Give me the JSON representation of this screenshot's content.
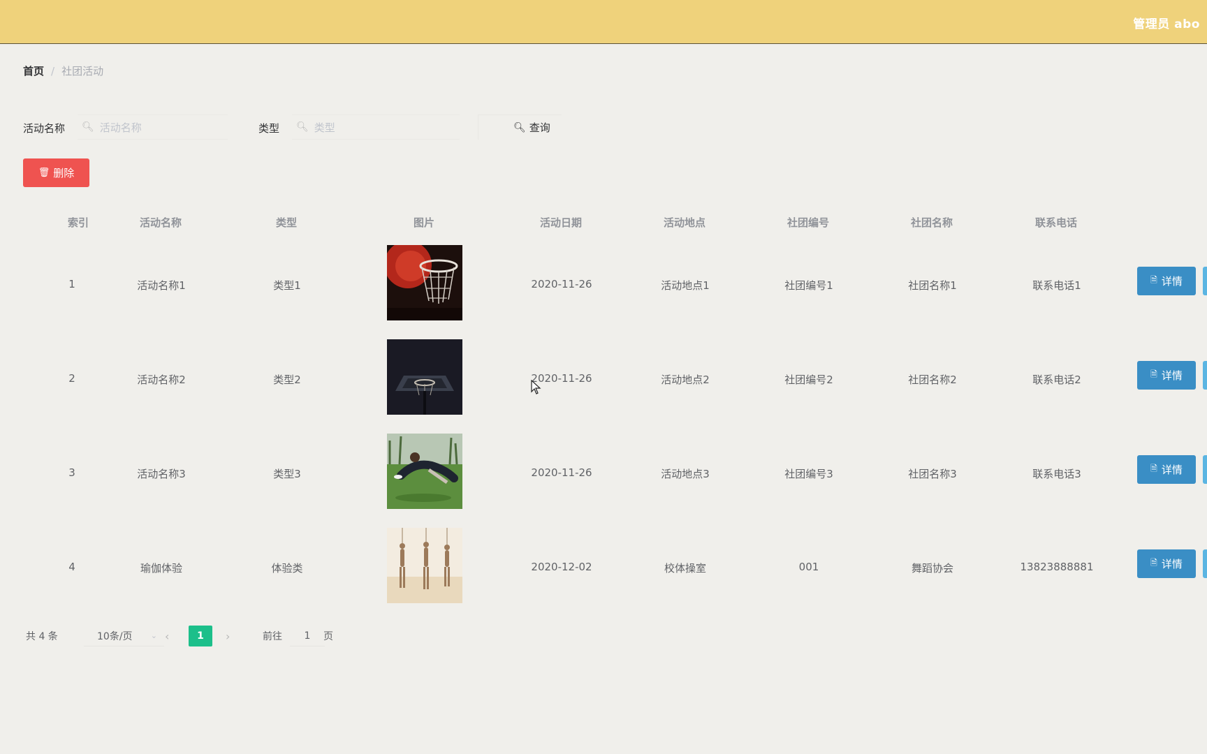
{
  "header": {
    "user_label": "管理员 abo",
    "bg_color": "#efd27b"
  },
  "breadcrumb": {
    "home": "首页",
    "separator": "/",
    "current": "社团活动"
  },
  "search": {
    "name_label": "活动名称",
    "name_placeholder": "活动名称",
    "type_label": "类型",
    "type_placeholder": "类型",
    "query_button": "查询"
  },
  "actions": {
    "delete_button": "删除",
    "delete_color": "#ef5350"
  },
  "table": {
    "columns": [
      "索引",
      "活动名称",
      "类型",
      "图片",
      "活动日期",
      "活动地点",
      "社团编号",
      "社团名称",
      "联系电话"
    ],
    "rows": [
      {
        "index": "1",
        "name": "活动名称1",
        "type": "类型1",
        "image": "basketball-hoop-red",
        "date": "2020-11-26",
        "place": "活动地点1",
        "club_no": "社团编号1",
        "club_name": "社团名称1",
        "phone": "联系电话1",
        "detail": "详情"
      },
      {
        "index": "2",
        "name": "活动名称2",
        "type": "类型2",
        "image": "basketball-hoop-night",
        "date": "2020-11-26",
        "place": "活动地点2",
        "club_no": "社团编号2",
        "club_name": "社团名称2",
        "phone": "联系电话2",
        "detail": "详情"
      },
      {
        "index": "3",
        "name": "活动名称3",
        "type": "类型3",
        "image": "frisbee-player-grass",
        "date": "2020-11-26",
        "place": "活动地点3",
        "club_no": "社团编号3",
        "club_name": "社团名称3",
        "phone": "联系电话3",
        "detail": "详情"
      },
      {
        "index": "4",
        "name": "瑜伽体验",
        "type": "体验类",
        "image": "yoga-dancers",
        "date": "2020-12-02",
        "place": "校体操室",
        "club_no": "001",
        "club_name": "舞蹈协会",
        "phone": "13823888881",
        "detail": "详情"
      }
    ],
    "detail_color": "#3a8ec5"
  },
  "pagination": {
    "total": "共 4 条",
    "page_size": "10条/页",
    "current_page": "1",
    "goto_label": "前往",
    "goto_value": "1",
    "goto_suffix": "页",
    "active_color": "#1cbf8a"
  }
}
